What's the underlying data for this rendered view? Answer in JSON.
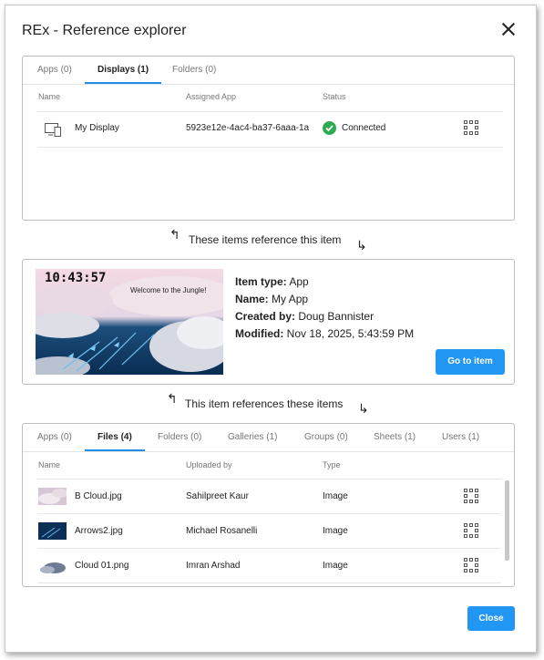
{
  "dialog": {
    "title": "REx - Reference explorer",
    "close_button": "Close"
  },
  "top_panel": {
    "tabs": [
      {
        "label": "Apps (0)",
        "active": false
      },
      {
        "label": "Displays (1)",
        "active": true
      },
      {
        "label": "Folders (0)",
        "active": false
      }
    ],
    "columns": [
      "Name",
      "Assigned App",
      "Status"
    ],
    "rows": [
      {
        "name": "My Display",
        "assigned_app": "5923e12e-4ac4-ba37-6aaa-1a",
        "status": "Connected",
        "icon": "display-icon"
      }
    ]
  },
  "reference_label_1": "These items reference this item",
  "item": {
    "clock": "10:43:57",
    "banner": "Welcome to the Jungle!",
    "type_label": "Item type:",
    "type_value": "App",
    "name_label": "Name:",
    "name_value": "My App",
    "created_label": "Created by:",
    "created_value": "Doug Bannister",
    "modified_label": "Modified:",
    "modified_value": "Nov 18, 2025, 5:43:59 PM",
    "goto_button": "Go to item"
  },
  "reference_label_2": "This item references these items",
  "bottom_panel": {
    "tabs": [
      {
        "label": "Apps (0)",
        "active": false
      },
      {
        "label": "Files (4)",
        "active": true
      },
      {
        "label": "Folders (0)",
        "active": false
      },
      {
        "label": "Galleries (1)",
        "active": false
      },
      {
        "label": "Groups (0)",
        "active": false
      },
      {
        "label": "Sheets (1)",
        "active": false
      },
      {
        "label": "Users (1)",
        "active": false
      }
    ],
    "columns": [
      "Name",
      "Uploaded by",
      "Type"
    ],
    "rows": [
      {
        "name": "B Cloud.jpg",
        "uploaded_by": "Sahilpreet Kaur",
        "type": "Image"
      },
      {
        "name": "Arrows2.jpg",
        "uploaded_by": "Michael Rosanelli",
        "type": "Image"
      },
      {
        "name": "Cloud 01.png",
        "uploaded_by": "Imran Arshad",
        "type": "Image"
      }
    ]
  },
  "colors": {
    "accent": "#2196f3",
    "status_ok": "#2eaa4f"
  }
}
